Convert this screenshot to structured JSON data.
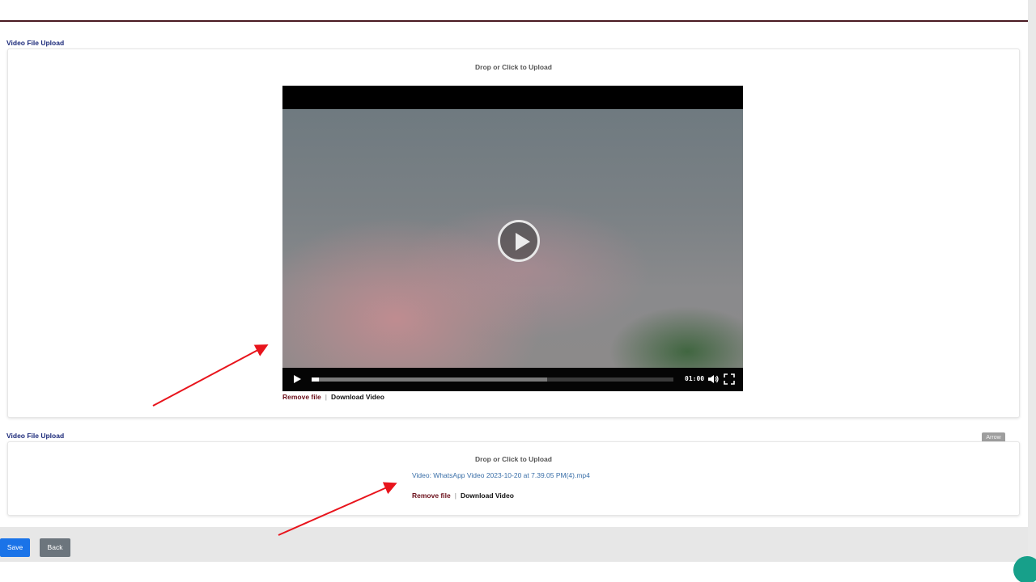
{
  "sections": [
    {
      "label": "Video File Upload",
      "drop_text": "Drop or Click to Upload",
      "player": {
        "time": "01:00",
        "progress": 0.02,
        "buffered": 0.65
      },
      "remove_label": "Remove file",
      "separator": "|",
      "download_label": "Download Video"
    },
    {
      "label": "Video File Upload",
      "drop_text": "Drop or Click to Upload",
      "file_name": "Video: WhatsApp Video 2023-10-20 at 7.39.05 PM(4).mp4",
      "remove_label": "Remove file",
      "separator": "|",
      "download_label": "Download Video"
    }
  ],
  "arrow_badge": "Arrow",
  "buttons": {
    "save": "Save",
    "back": "Back"
  },
  "colors": {
    "accent": "#1a73e8",
    "remove_link": "#6b0f1a",
    "label": "#1c2a7a",
    "annotation_arrow": "#e8141c"
  },
  "icons": [
    "play-icon",
    "volume-icon",
    "fullscreen-icon"
  ]
}
